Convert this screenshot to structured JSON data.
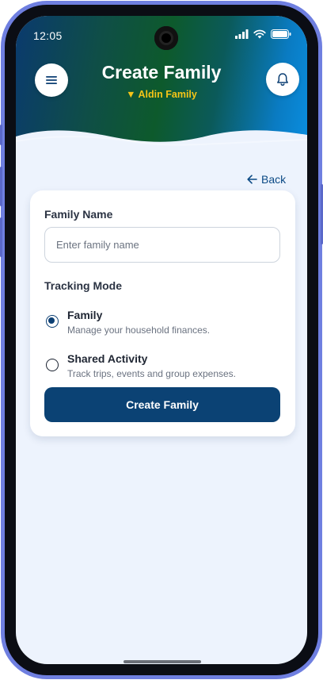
{
  "status_bar": {
    "time": "12:05"
  },
  "header": {
    "title": "Create Family",
    "subtitle": "▼ Aldin Family",
    "menu_icon": "hamburger-menu-icon",
    "bell_icon": "bell-icon"
  },
  "nav": {
    "back_label": "Back",
    "back_icon": "arrow-left-icon"
  },
  "form": {
    "family_name_label": "Family Name",
    "family_name_value": "",
    "family_name_placeholder": "Enter family name",
    "tracking_mode_label": "Tracking Mode",
    "options": [
      {
        "title": "Family",
        "description": "Manage your household finances.",
        "selected": true
      },
      {
        "title": "Shared Activity",
        "description": "Track trips, events and group expenses.",
        "selected": false
      }
    ],
    "submit_label": "Create Family"
  },
  "colors": {
    "primary": "#0b4274",
    "accent_yellow": "#f5c518",
    "background": "#edf3fd",
    "frame": "#6f7fe0"
  }
}
